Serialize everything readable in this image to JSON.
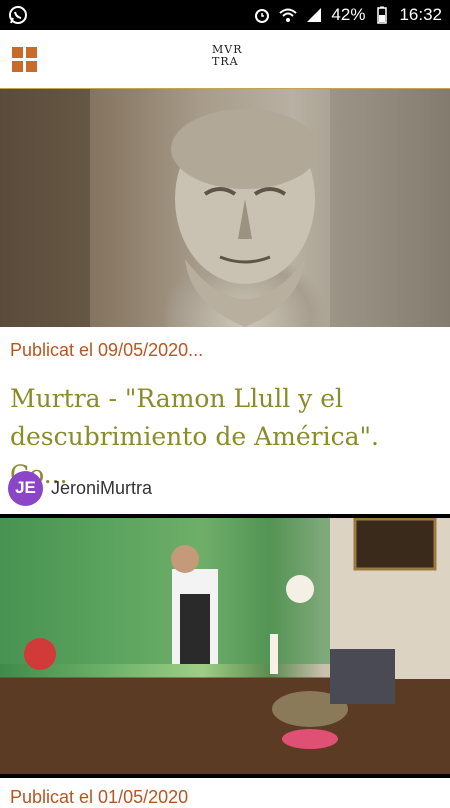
{
  "statusbar": {
    "battery": "42%",
    "time": "16:32",
    "left_icon": "whatsapp-icon",
    "right_icons": [
      "alarm-icon",
      "wifi-icon",
      "signal-icon",
      "battery-icon"
    ]
  },
  "appbar": {
    "logo_line1": "MVR",
    "logo_line2": "TRA",
    "menu_icon": "grid-menu-icon"
  },
  "colors": {
    "accent_orange": "#c96a2a",
    "date_color": "#b9551f",
    "title_color": "#8a8c2a",
    "avatar_bg": "#8b46c8"
  },
  "posts": [
    {
      "date": "Publicat el 09/05/2020...",
      "title": "Murtra - \"Ramon Llull y el descubrimiento de América\". Co...",
      "author_initials": "JE",
      "author": "JeroniMurtra",
      "image": "stone-carved-face-photo"
    },
    {
      "date": "Publicat el 01/05/2020",
      "image": "man-speaking-in-room-photo"
    }
  ]
}
